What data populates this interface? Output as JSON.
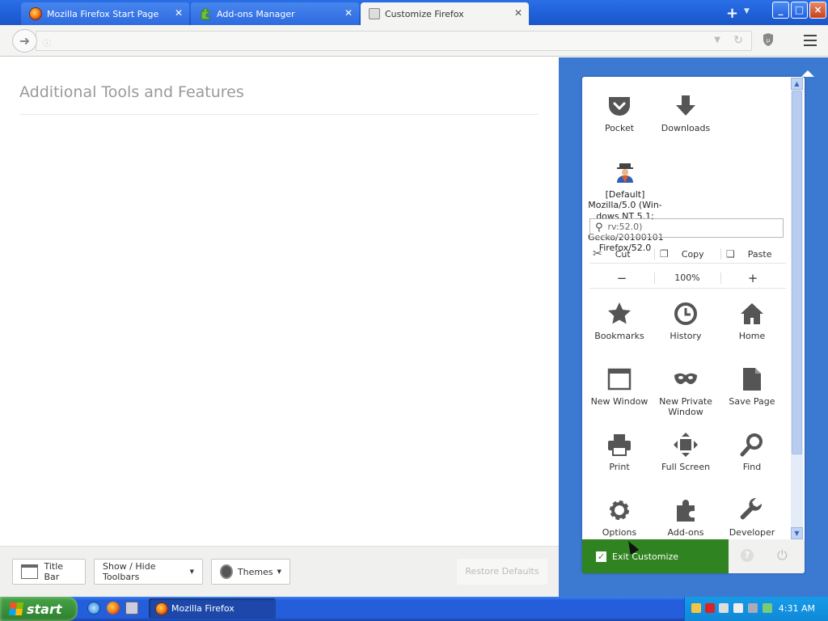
{
  "tabs": [
    {
      "label": "Mozilla Firefox Start Page",
      "active": false,
      "icon": "firefox-icon"
    },
    {
      "label": "Add-ons Manager",
      "active": false,
      "icon": "puzzle-icon"
    },
    {
      "label": "Customize Firefox",
      "active": true,
      "icon": "customize-icon"
    }
  ],
  "window_controls": {
    "minimize": "_",
    "maximize": "□",
    "close": "×"
  },
  "toolbar": {
    "new_tab": "+"
  },
  "palette": {
    "title": "Additional Tools and Features"
  },
  "footer": {
    "title_bar": "Title Bar",
    "show_hide_toolbars": "Show / Hide Toolbars",
    "themes": "Themes",
    "restore_defaults": "Restore Defaults"
  },
  "panel": {
    "top_items": [
      {
        "label": "Pocket",
        "icon": "pocket-icon"
      },
      {
        "label": "Downloads",
        "icon": "downloads-icon"
      }
    ],
    "user_agent": {
      "lines": [
        "[Default]",
        "Mozilla/5.0 (Win-",
        "dows NT 5.1;",
        "rv:52.0)",
        "Gecko/20100101",
        "Firefox/52.0"
      ],
      "icon": "user-agent-switcher-icon"
    },
    "edit": {
      "cut": "Cut",
      "copy": "Copy",
      "paste": "Paste"
    },
    "zoom": {
      "out": "−",
      "level": "100%",
      "in": "+"
    },
    "grid": [
      {
        "label": "Bookmarks",
        "icon": "star-icon"
      },
      {
        "label": "History",
        "icon": "clock-icon"
      },
      {
        "label": "Home",
        "icon": "home-icon"
      },
      {
        "label": "New Window",
        "icon": "window-icon"
      },
      {
        "label": "New Private Window",
        "icon": "mask-icon"
      },
      {
        "label": "Save Page",
        "icon": "page-icon"
      },
      {
        "label": "Print",
        "icon": "printer-icon"
      },
      {
        "label": "Full Screen",
        "icon": "fullscreen-icon"
      },
      {
        "label": "Find",
        "icon": "magnifier-icon"
      },
      {
        "label": "Options",
        "icon": "gear-icon"
      },
      {
        "label": "Add-ons",
        "icon": "puzzle-icon"
      },
      {
        "label": "Developer",
        "icon": "wrench-icon"
      }
    ],
    "exit_customize": "Exit Customize",
    "help": "?"
  },
  "taskbar": {
    "start": "start",
    "task": "Mozilla Firefox",
    "clock": "4:31 AM"
  }
}
